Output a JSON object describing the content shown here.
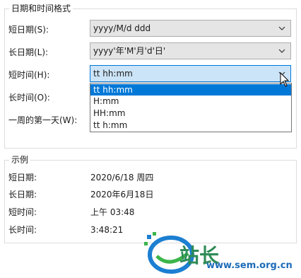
{
  "format_group": {
    "title": "日期和时间格式",
    "rows": [
      {
        "label": "短日期(S):",
        "value": "yyyy/M/d ddd"
      },
      {
        "label": "长日期(L):",
        "value": "yyyy'年'M'月'd'日'"
      },
      {
        "label": "短时间(H):",
        "value": "tt hh:mm"
      },
      {
        "label": "长时间(O):",
        "value": ""
      },
      {
        "label": "一周的第一天(W):",
        "value": ""
      }
    ]
  },
  "dropdown": {
    "options": [
      "tt hh:mm",
      "H:mm",
      "HH:mm",
      "tt h:mm"
    ],
    "selected": "tt hh:mm"
  },
  "sample_group": {
    "title": "示例",
    "rows": [
      {
        "label": "短日期:",
        "value": "2020/6/18 周四"
      },
      {
        "label": "长日期:",
        "value": "2020年6月18日"
      },
      {
        "label": "短时间:",
        "value": "上午 03:48"
      },
      {
        "label": "长时间:",
        "value": "3:48:21"
      }
    ]
  },
  "watermark": {
    "logo_text": "站长",
    "url": "www.sem.org.cn"
  }
}
